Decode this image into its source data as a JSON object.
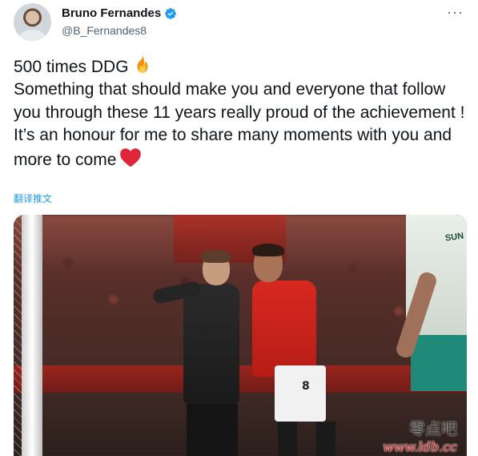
{
  "author": {
    "display_name": "Bruno Fernandes",
    "handle": "@B_Fernandes8",
    "verified": true
  },
  "tweet": {
    "lines": [
      "500 times DDG",
      "Something that should make you and everyone that follow you through these 11 years really proud of the achievement !",
      "It’s an honour for me to share many moments with you and more to come"
    ],
    "translate_label": "翻译推文"
  },
  "media": {
    "shirt_number": "8",
    "sponsor_text": "SUN",
    "watermark_cn": "零点吧",
    "watermark_url": "www.ldb.cc"
  },
  "icons": {
    "verified": "verified-badge-icon",
    "more": "more-icon",
    "fire": "fire-emoji-icon",
    "heart": "red-heart-emoji-icon"
  },
  "colors": {
    "accent": "#1d9bf0",
    "text_primary": "#0f1419",
    "text_secondary": "#536471",
    "heart": "#e0243a"
  }
}
